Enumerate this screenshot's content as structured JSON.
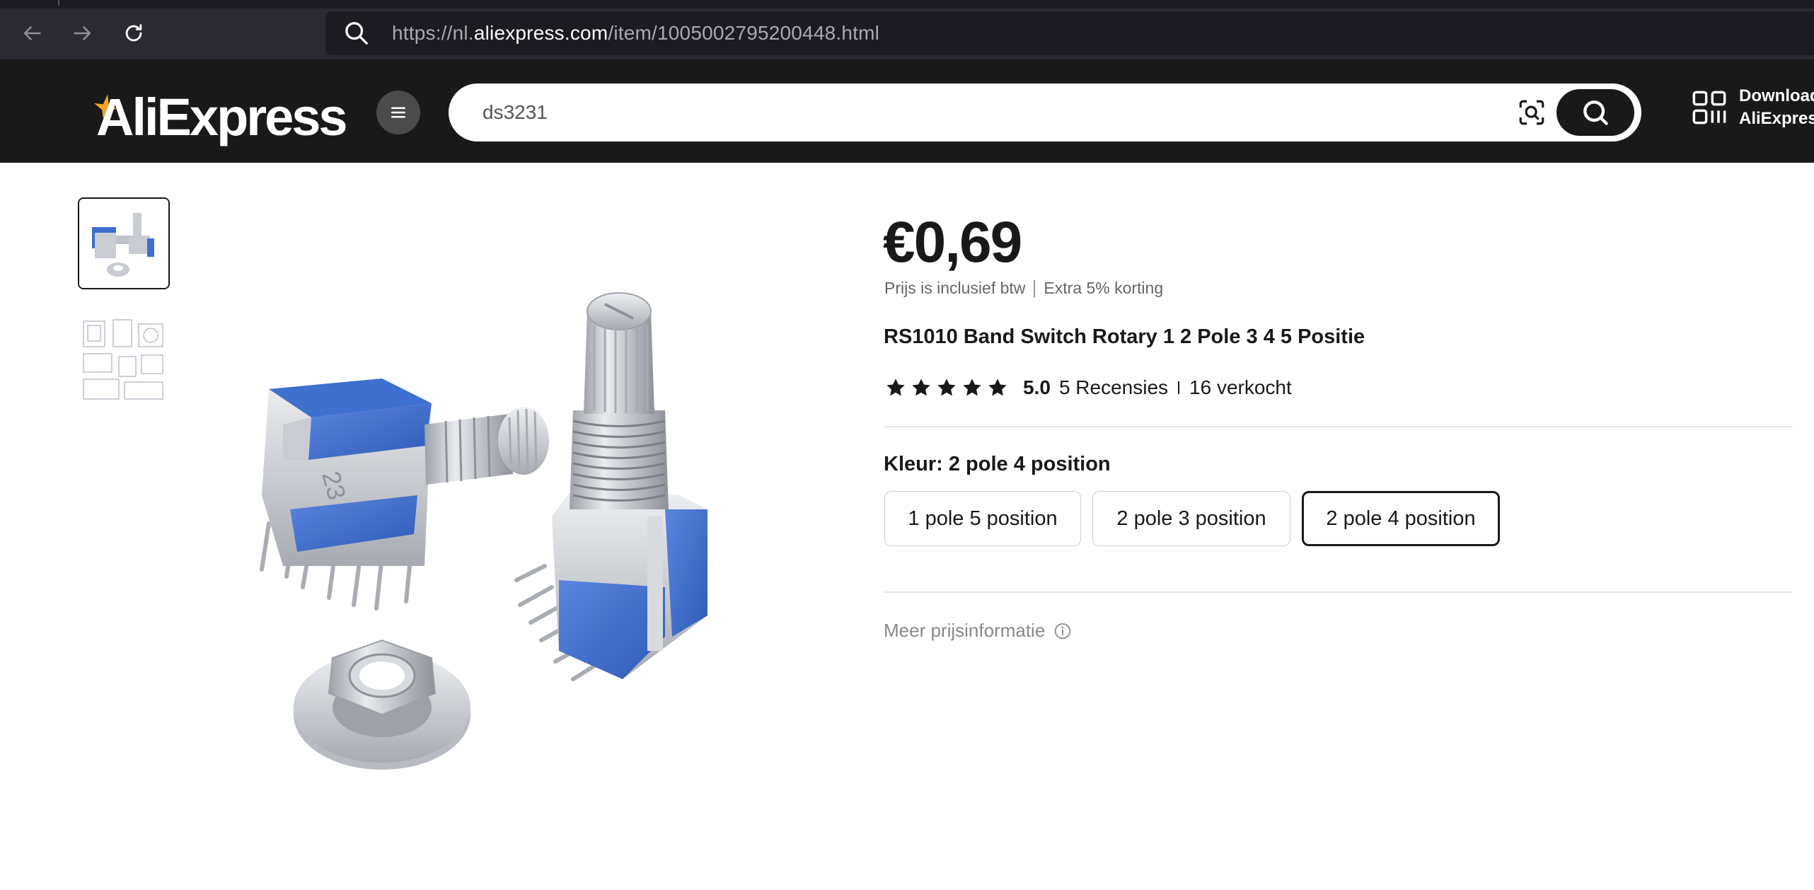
{
  "browser": {
    "url_prefix": "https://nl.",
    "url_host": "aliexpress.com",
    "url_path": "/item/1005002795200448.html"
  },
  "header": {
    "logo_text": "AliExpress",
    "search_value": "ds3231",
    "download_line1": "Download",
    "download_line2": "AliExpress"
  },
  "product": {
    "price": "€0,69",
    "tax_note": "Prijs is inclusief btw",
    "discount_note": "Extra 5% korting",
    "title": "RS1010 Band Switch Rotary 1 2 Pole 3 4 5 Positie",
    "rating": "5.0",
    "reviews": "5 Recensies",
    "sold": "16 verkocht",
    "color_label": "Kleur: 2 pole 4 position",
    "options": [
      "1 pole 5 position",
      "2 pole 3 position",
      "2 pole 4 position"
    ],
    "selected_option": 2,
    "more_price_info": "Meer prijsinformatie"
  },
  "colors": {
    "header_bg": "#191919",
    "browser_bg": "#2b2a33",
    "accent_star": "#f7a325",
    "knob_blue": "#3f6fcf"
  },
  "icons": [
    "back-arrow-icon",
    "forward-arrow-icon",
    "reload-icon",
    "search-icon",
    "menu-icon",
    "camera-search-icon",
    "qr-code-icon",
    "star-icon",
    "info-icon"
  ]
}
